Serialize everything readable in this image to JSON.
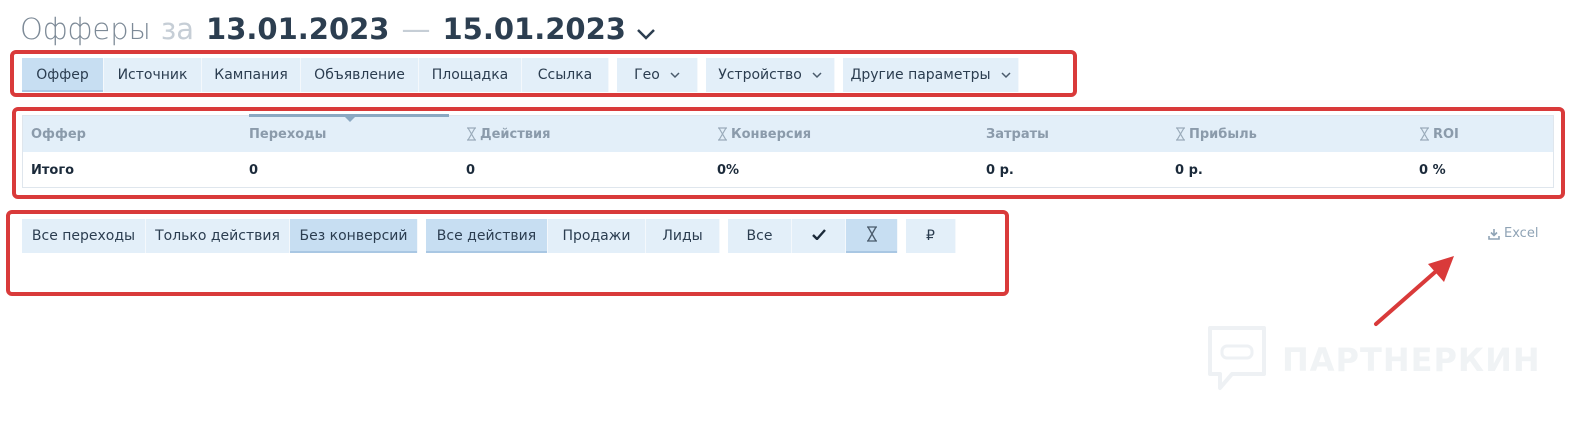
{
  "header": {
    "title": "Офферы",
    "za": "за",
    "date_from": "13.01.2023",
    "dash": "—",
    "date_to": "15.01.2023"
  },
  "group_tabs": [
    {
      "label": "Оффер",
      "active": true
    },
    {
      "label": "Источник"
    },
    {
      "label": "Кампания"
    },
    {
      "label": "Объявление"
    },
    {
      "label": "Площадка"
    },
    {
      "label": "Ссылка"
    }
  ],
  "group_dropdowns": [
    {
      "label": "Гео"
    },
    {
      "label": "Устройство"
    },
    {
      "label": "Другие параметры"
    }
  ],
  "table": {
    "columns": [
      "Оффер",
      "Переходы",
      "Действия",
      "Конверсия",
      "Затраты",
      "Прибыль",
      "ROI"
    ],
    "total_row": [
      "Итого",
      "0",
      "0",
      "0%",
      "0 р.",
      "0 р.",
      "0 %"
    ]
  },
  "filters": {
    "traffic": [
      "Все переходы",
      "Только действия",
      "Без конверсий"
    ],
    "actions": [
      "Все действия",
      "Продажи",
      "Лиды"
    ],
    "status": {
      "all_label": "Все",
      "currency_label": "₽"
    }
  },
  "excel_label": "Excel",
  "watermark": "ПАРТНЕРКИН",
  "colors": {
    "accent": "#c7def2",
    "tab": "#e3eff9",
    "annotation": "#d93a3a"
  }
}
